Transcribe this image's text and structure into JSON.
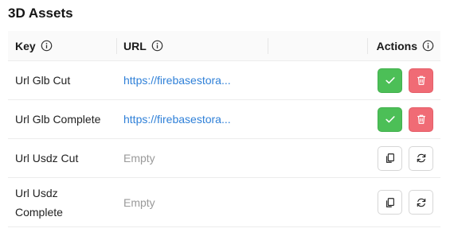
{
  "section": {
    "title": "3D Assets"
  },
  "table": {
    "headers": {
      "key": "Key",
      "url": "URL",
      "actions": "Actions"
    },
    "rows": [
      {
        "key": "Url Glb Cut",
        "url": "https://firebasestora...",
        "url_state": "link",
        "actions": [
          "confirm",
          "delete"
        ]
      },
      {
        "key": "Url Glb Complete",
        "url": "https://firebasestora...",
        "url_state": "link",
        "actions": [
          "confirm",
          "delete"
        ]
      },
      {
        "key": "Url Usdz Cut",
        "url": "Empty",
        "url_state": "empty",
        "actions": [
          "copy",
          "refresh"
        ]
      },
      {
        "key_line1": "Url Usdz",
        "key_line2": "Complete",
        "url": "Empty",
        "url_state": "empty",
        "actions": [
          "copy",
          "refresh"
        ]
      }
    ]
  },
  "icons": {
    "info": "info-circle-icon",
    "confirm": "check-icon",
    "delete": "trash-icon",
    "copy": "copy-icon",
    "refresh": "refresh-icon"
  },
  "colors": {
    "link": "#2f80d8",
    "confirm_bg": "#4cbf57",
    "delete_bg": "#f06b75",
    "muted": "#9a9a9a"
  }
}
